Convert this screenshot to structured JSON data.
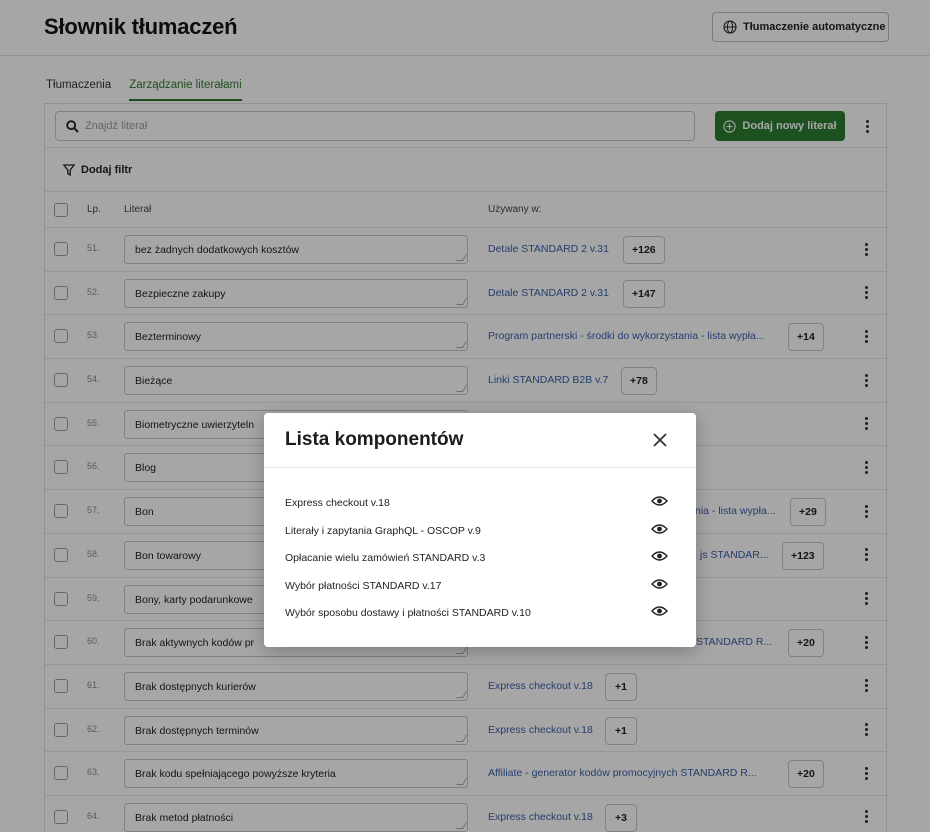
{
  "header": {
    "title": "Słownik tłumaczeń",
    "auto_translate_label": "Tłumaczenie automatyczne"
  },
  "tabs": [
    {
      "label": "Tłumaczenia",
      "active": false
    },
    {
      "label": "Zarządzanie literałami",
      "active": true
    }
  ],
  "toolbar": {
    "search_placeholder": "Znajdź literał",
    "add_label": "Dodaj nowy literał"
  },
  "filter": {
    "label": "Dodaj filtr"
  },
  "table": {
    "columns": {
      "lp": "Lp.",
      "literal": "Literał",
      "used_in": "Używany w:"
    },
    "rows": [
      {
        "num": "51.",
        "literal": "bez żadnych dodatkowych kosztów",
        "used_in": "Detale STANDARD 2 v.31",
        "count": "+126"
      },
      {
        "num": "52.",
        "literal": "Bezpieczne zakupy",
        "used_in": "Detale STANDARD 2 v.31",
        "count": "+147"
      },
      {
        "num": "53.",
        "literal": "Bezterminowy",
        "used_in": "Program partnerski - środki do wykorzystania - lista wypła...",
        "count": "+14"
      },
      {
        "num": "54.",
        "literal": "Bieżące",
        "used_in": "Linki STANDARD B2B v.7",
        "count": "+78"
      },
      {
        "num": "55.",
        "literal": "Biometryczne uwierzyteln",
        "used_in": "",
        "count": ""
      },
      {
        "num": "56.",
        "literal": "Blog",
        "used_in": "",
        "count": ""
      },
      {
        "num": "57.",
        "literal": "Bon",
        "used_in": "nia - lista wypła...",
        "count": "+29"
      },
      {
        "num": "58.",
        "literal": "Bon towarowy",
        "used_in": "js STANDAR...",
        "count": "+123"
      },
      {
        "num": "59.",
        "literal": "Bony, karty podarunkowe",
        "used_in": "",
        "count": ""
      },
      {
        "num": "60.",
        "literal": "Brak aktywnych kodów pr",
        "used_in": "STANDARD R...",
        "count": "+20"
      },
      {
        "num": "61.",
        "literal": "Brak dostępnych kurierów",
        "used_in": "Express checkout v.18",
        "count": "+1"
      },
      {
        "num": "62.",
        "literal": "Brak dostępnych terminów",
        "used_in": "Express checkout v.18",
        "count": "+1"
      },
      {
        "num": "63.",
        "literal": "Brak kodu spełniającego powyższe kryteria",
        "used_in": "Affiliate - generator kodów promocyjnych STANDARD R...",
        "count": "+20"
      },
      {
        "num": "64.",
        "literal": "Brak metod płatności",
        "used_in": "Express checkout v.18",
        "count": "+3"
      }
    ]
  },
  "modal": {
    "title": "Lista komponentów",
    "items": [
      "Express checkout v.18",
      "Literały i zapytania GraphQL - OSCOP v.9",
      "Opłacanie wielu zamówień STANDARD v.3",
      "Wybór płatności STANDARD v.17",
      "Wybór sposobu dostawy i płatności STANDARD v.10"
    ]
  },
  "colors": {
    "accent": "#2e7d32",
    "link": "#3a5fa8"
  }
}
